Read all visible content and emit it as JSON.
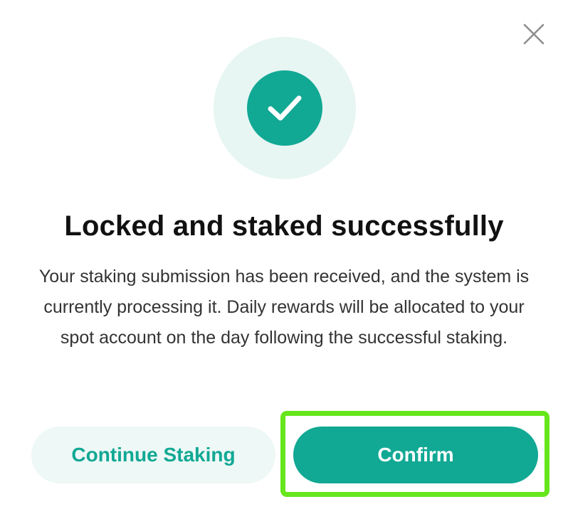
{
  "dialog": {
    "title": "Locked and staked successfully",
    "message": "Your staking submission has been received, and the system is currently processing it. Daily rewards will be allocated to your spot account on the day following the successful staking.",
    "close_icon": "close-icon",
    "status_icon": "checkmark-icon"
  },
  "buttons": {
    "continue_label": "Continue Staking",
    "confirm_label": "Confirm"
  },
  "colors": {
    "accent": "#11a894",
    "accent_light": "#e7f6f3",
    "secondary_button_bg": "#eef8f6",
    "highlight": "#66e61c"
  }
}
